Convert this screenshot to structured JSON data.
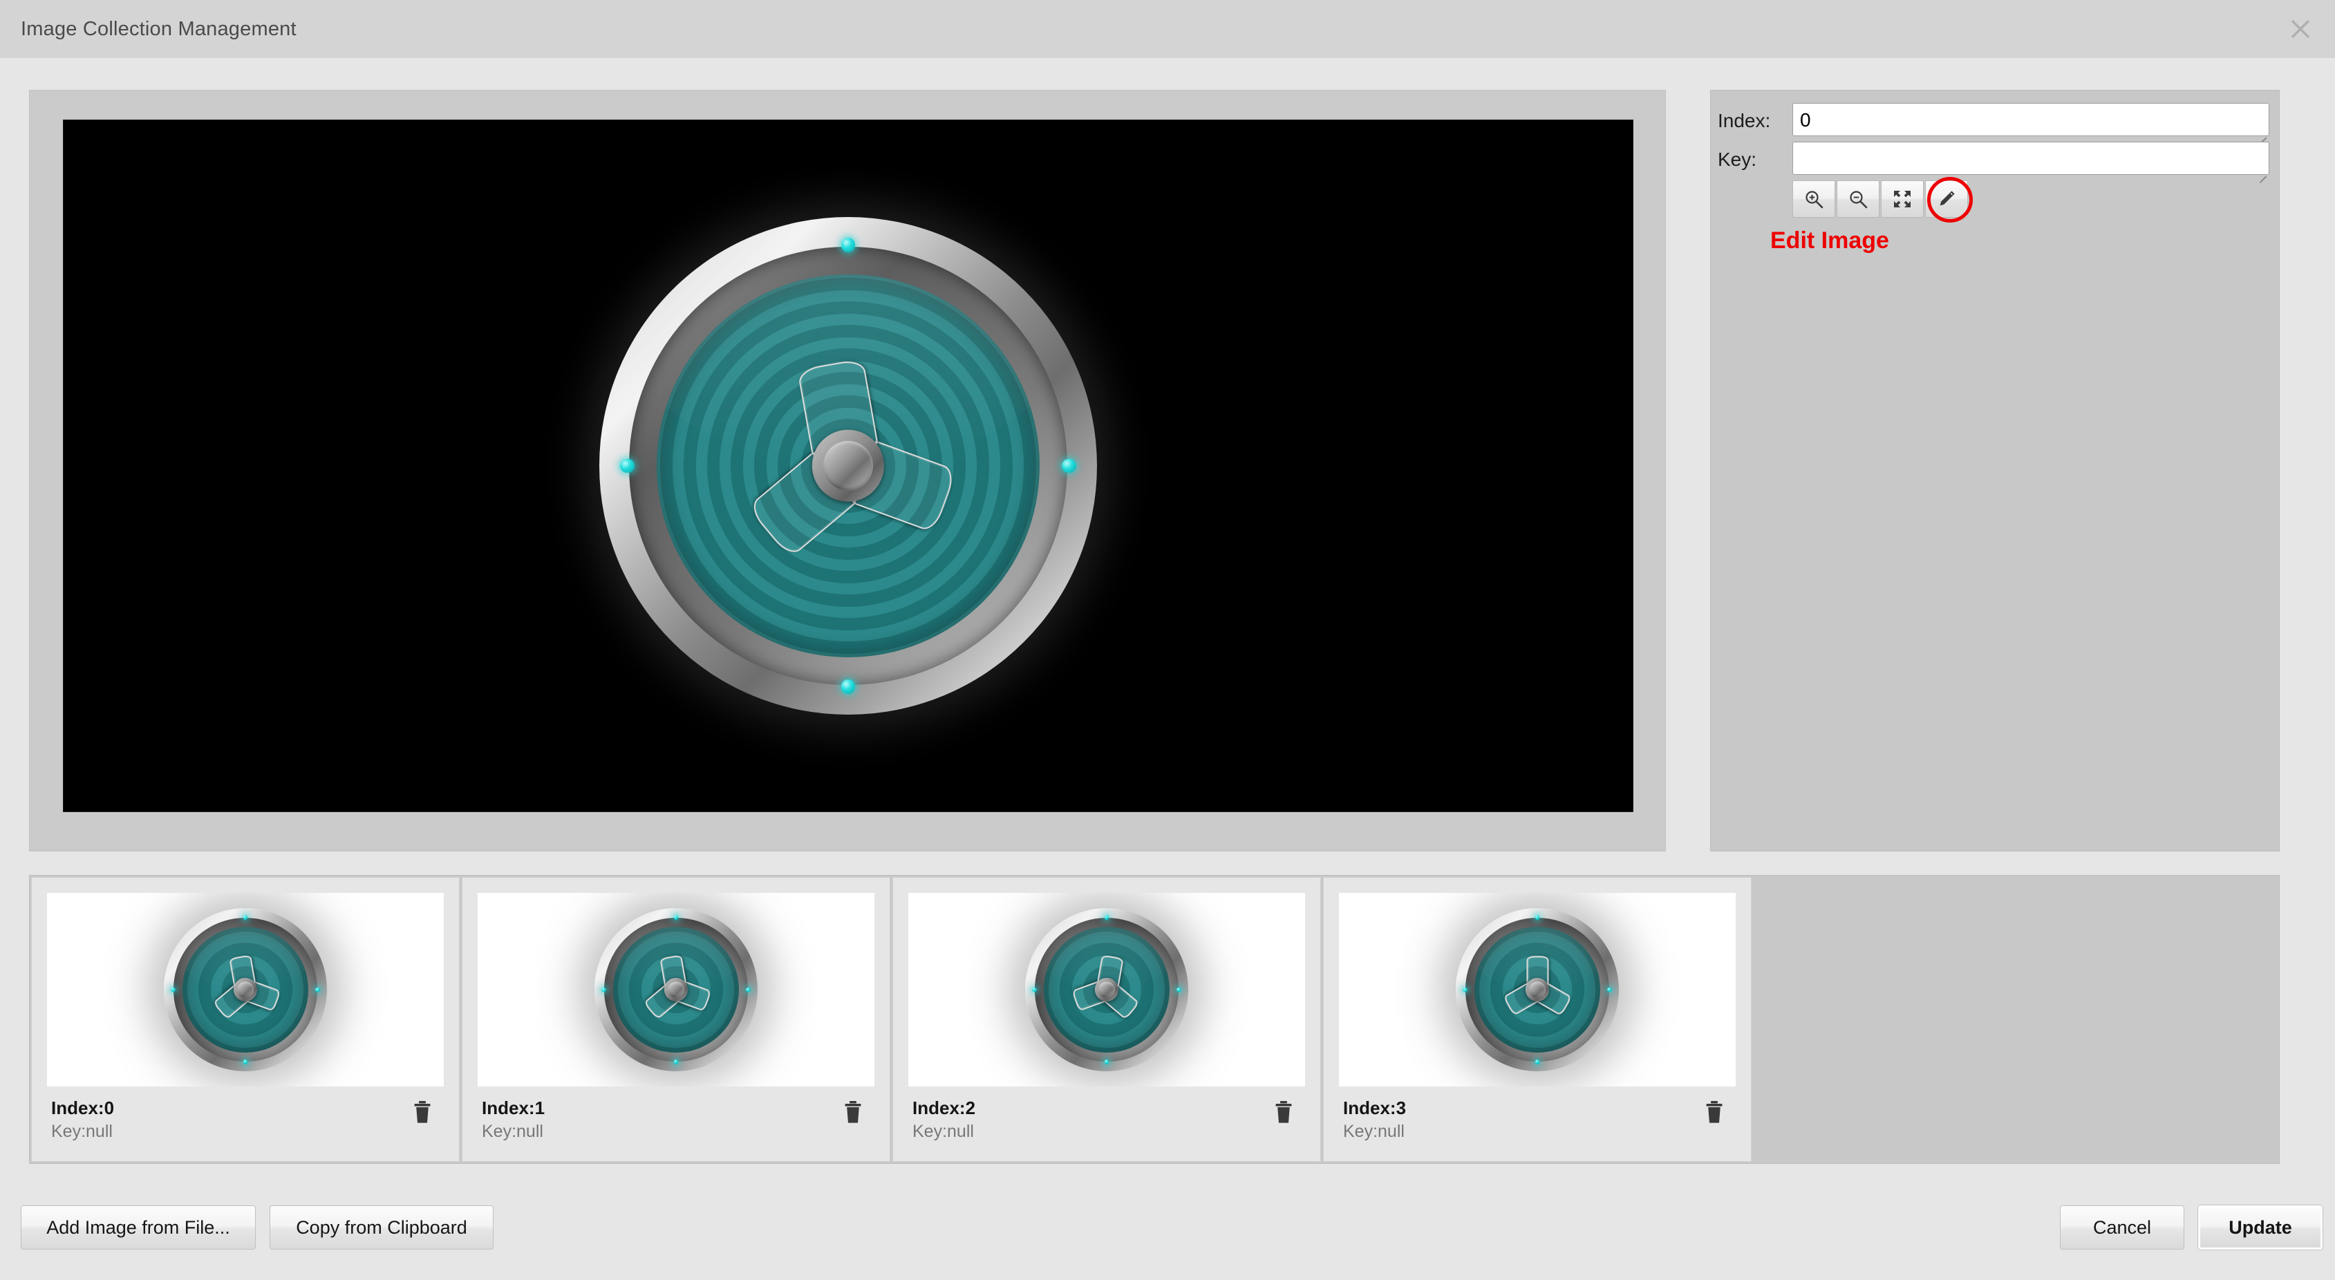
{
  "window": {
    "title": "Image Collection Management",
    "close_icon": "close-icon"
  },
  "preview": {
    "background_color": "#000000",
    "image_alt": "fan-radiation-disc"
  },
  "properties": {
    "index_label": "Index:",
    "index_value": "0",
    "key_label": "Key:",
    "key_value": "",
    "toolbar": [
      {
        "name": "zoom-in-icon",
        "tooltip": "Zoom In"
      },
      {
        "name": "zoom-out-icon",
        "tooltip": "Zoom Out"
      },
      {
        "name": "fit-to-screen-icon",
        "tooltip": "Fit to Screen"
      },
      {
        "name": "edit-pencil-icon",
        "tooltip": "Edit Image"
      }
    ],
    "annotation": {
      "text": "Edit Image",
      "color": "#ee0000",
      "target": "edit-pencil-icon"
    }
  },
  "thumbnails": [
    {
      "index_label": "Index:0",
      "key_label": "Key:null",
      "delete_icon": "trash-icon",
      "blade_rotation": 20
    },
    {
      "index_label": "Index:1",
      "key_label": "Key:null",
      "delete_icon": "trash-icon",
      "blade_rotation": 20
    },
    {
      "index_label": "Index:2",
      "key_label": "Key:null",
      "delete_icon": "trash-icon",
      "blade_rotation": 40
    },
    {
      "index_label": "Index:3",
      "key_label": "Key:null",
      "delete_icon": "trash-icon",
      "blade_rotation": 270
    }
  ],
  "footer": {
    "add_from_file": "Add Image from File...",
    "copy_from_clipboard": "Copy from Clipboard",
    "cancel": "Cancel",
    "update": "Update"
  },
  "colors": {
    "titlebar": "#d4d4d4",
    "body": "#e6e6e6",
    "panel": "#c8c8c8",
    "card": "#e6e6e6",
    "teal_light": "#2c8a8c",
    "teal_dark": "#1e7375",
    "led_cyan": "#22dcdc",
    "annotation_red": "#ee0000"
  }
}
